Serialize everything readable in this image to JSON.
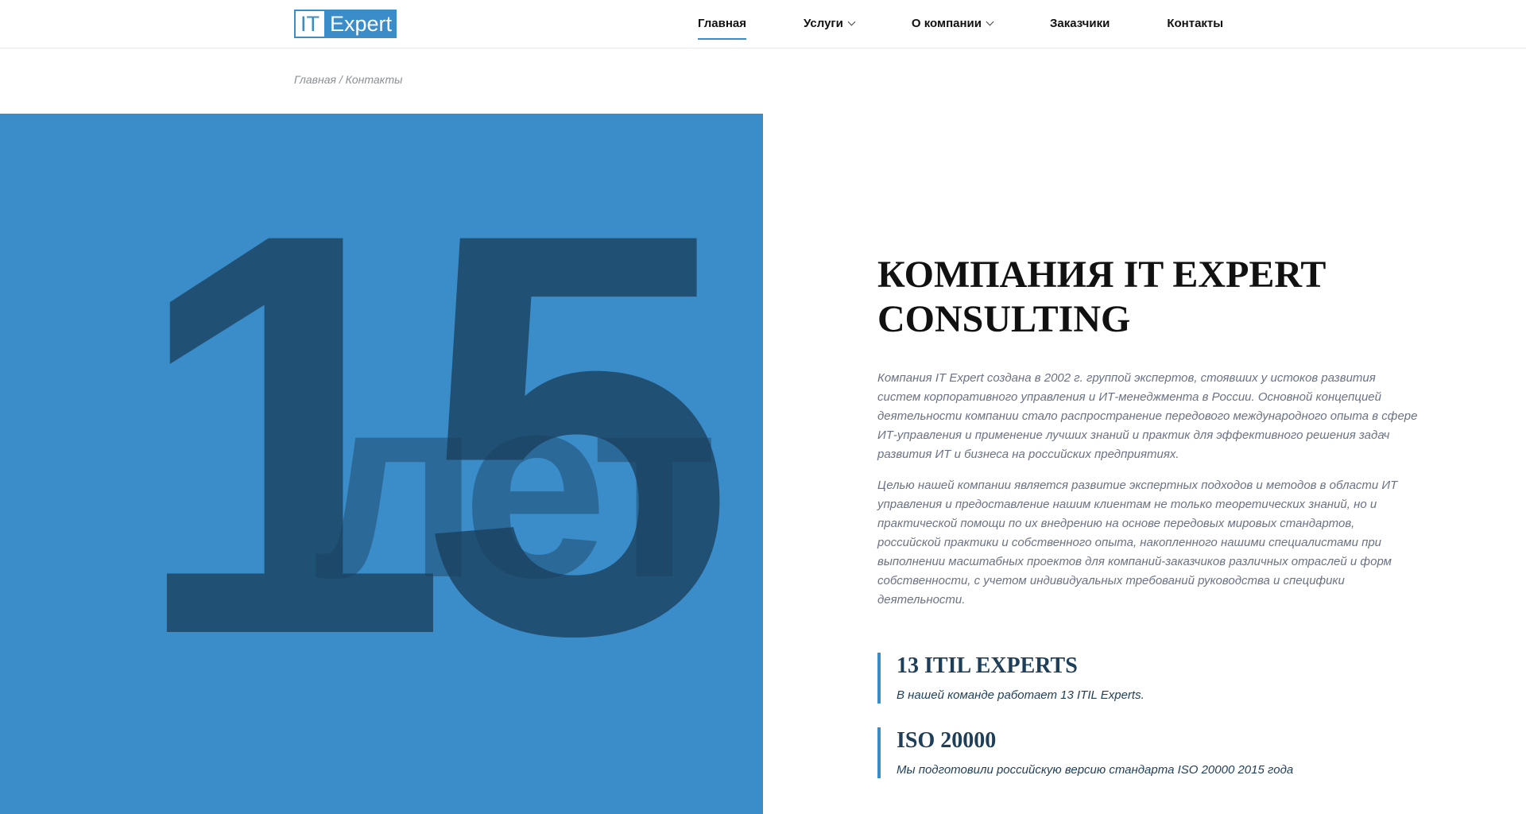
{
  "colors": {
    "accent": "#3a8dc8",
    "dark_overlay": "#1b3f5e"
  },
  "header": {
    "logo": {
      "it": "IT",
      "expert": "Expert"
    },
    "nav": [
      {
        "label": "Главная",
        "active": true,
        "dropdown": false
      },
      {
        "label": "Услуги",
        "active": false,
        "dropdown": true
      },
      {
        "label": "О компании",
        "active": false,
        "dropdown": true
      },
      {
        "label": "Заказчики",
        "active": false,
        "dropdown": false
      },
      {
        "label": "Контакты",
        "active": false,
        "dropdown": false
      }
    ]
  },
  "breadcrumb": {
    "home": "Главная",
    "separator": "/",
    "current": "Контакты"
  },
  "hero": {
    "big_number": "15",
    "big_word": "лет"
  },
  "main": {
    "title": "КОМПАНИЯ IT EXPERT CONSULTING",
    "paragraphs": [
      "Компания IT Expert создана в 2002 г. группой экспертов, стоявших у истоков развития систем корпоративного управления и ИТ-менеджмента в России. Основной концепцией деятельности компании стало распространение передового международного опыта в сфере ИТ-управления и применение лучших знаний и практик для эффективного решения задач развития ИТ и бизнеса на российских предприятиях.",
      "Целью нашей компании является развитие экспертных подходов и методов в области ИТ управления и предоставление нашим клиентам не только теоретических знаний, но и практической помощи по их внедрению на основе передовых мировых стандартов, российской практики и собственного опыта, накопленного нашими специалистами при выполнении масштабных проектов для компаний-заказчиков различных отраслей и форм собственности, с учетом индивидуальных требований руководства и специфики деятельности."
    ],
    "facts": [
      {
        "title": "13 ITIL EXPERTS",
        "text": "В нашей команде работает 13 ITIL Experts."
      },
      {
        "title": "ISO 20000",
        "text": "Мы подготовили российскую версию стандарта ISO 20000 2015 года"
      }
    ]
  }
}
